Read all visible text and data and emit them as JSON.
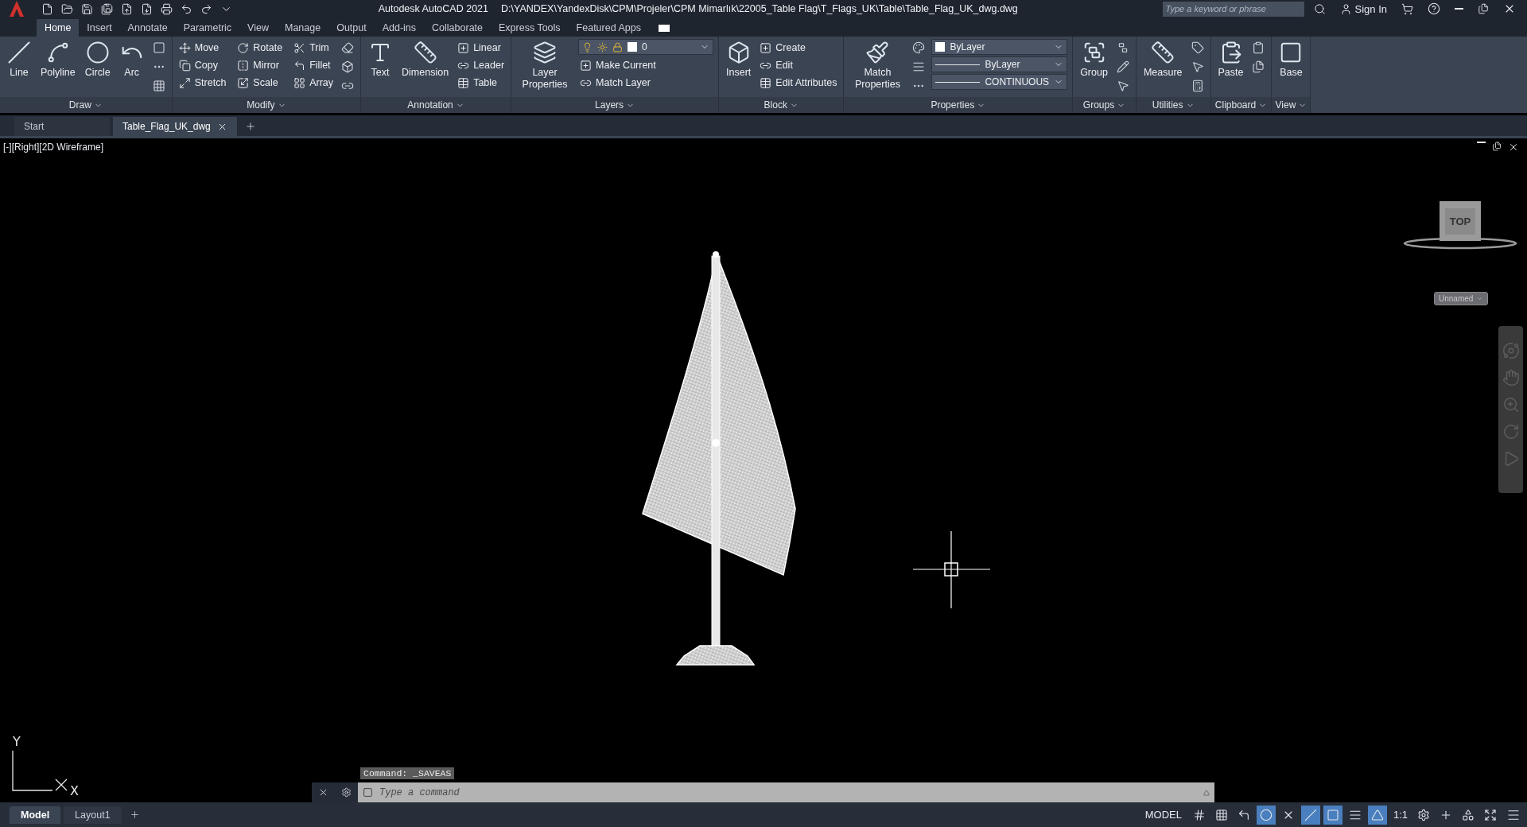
{
  "title": {
    "app": "Autodesk AutoCAD 2021",
    "path": "D:\\YANDEX\\YandexDisk\\CPM\\Projeler\\CPM Mimarlık\\22005_Table Flag\\T_Flags_UK\\Table\\Table_Flag_UK_dwg.dwg"
  },
  "search": {
    "placeholder": "Type a keyword or phrase"
  },
  "sign_in": "Sign In",
  "ribbon_tabs": [
    {
      "label": "Home",
      "selected": true
    },
    {
      "label": "Insert",
      "selected": false
    },
    {
      "label": "Annotate",
      "selected": false
    },
    {
      "label": "Parametric",
      "selected": false
    },
    {
      "label": "View",
      "selected": false
    },
    {
      "label": "Manage",
      "selected": false
    },
    {
      "label": "Output",
      "selected": false
    },
    {
      "label": "Add-ins",
      "selected": false
    },
    {
      "label": "Collaborate",
      "selected": false
    },
    {
      "label": "Express Tools",
      "selected": false
    },
    {
      "label": "Featured Apps",
      "selected": false
    }
  ],
  "panels": [
    {
      "title": "Draw",
      "big": [
        "Line",
        "Polyline",
        "Circle",
        "Arc"
      ]
    },
    {
      "title": "Modify",
      "small": [
        "Move",
        "Rotate",
        "Trim",
        "Copy",
        "Mirror",
        "Fillet",
        "Stretch",
        "Scale",
        "Array"
      ]
    },
    {
      "title": "Annotation",
      "big": [
        "Text",
        "Dimension"
      ],
      "small": [
        "Linear",
        "Leader",
        "Table"
      ]
    },
    {
      "title": "Layers",
      "big": [
        "Layer Properties"
      ],
      "dropdowns": [
        "0"
      ],
      "small": [
        "Make Current",
        "Match Layer"
      ]
    },
    {
      "title": "Block",
      "big": [
        "Insert"
      ],
      "small": [
        "Create",
        "Edit",
        "Edit Attributes"
      ]
    },
    {
      "title": "Properties",
      "big": [
        "Match Properties"
      ],
      "dropdowns": [
        "ByLayer",
        "ByLayer",
        "CONTINUOUS"
      ]
    },
    {
      "title": "Groups",
      "big": [
        "Group"
      ]
    },
    {
      "title": "Utilities",
      "big": [
        "Measure"
      ]
    },
    {
      "title": "Clipboard",
      "big": [
        "Paste"
      ]
    },
    {
      "title": "View",
      "big": [
        "Base"
      ]
    }
  ],
  "doc_tabs": [
    {
      "label": "Start",
      "selected": false
    },
    {
      "label": "Table_Flag_UK_dwg",
      "selected": true
    }
  ],
  "viewport": {
    "label": "[-][Right][2D Wireframe]",
    "viewcube": "TOP",
    "ucs_name": "Unnamed",
    "ucs_axes": [
      "Y",
      "X"
    ]
  },
  "command": {
    "history": "Command: _SAVEAS",
    "placeholder": "Type a command"
  },
  "layout_tabs": [
    {
      "label": "Model",
      "selected": true
    },
    {
      "label": "Layout1",
      "selected": false
    }
  ],
  "status_bar": {
    "space": "MODEL",
    "scale": "1:1"
  }
}
